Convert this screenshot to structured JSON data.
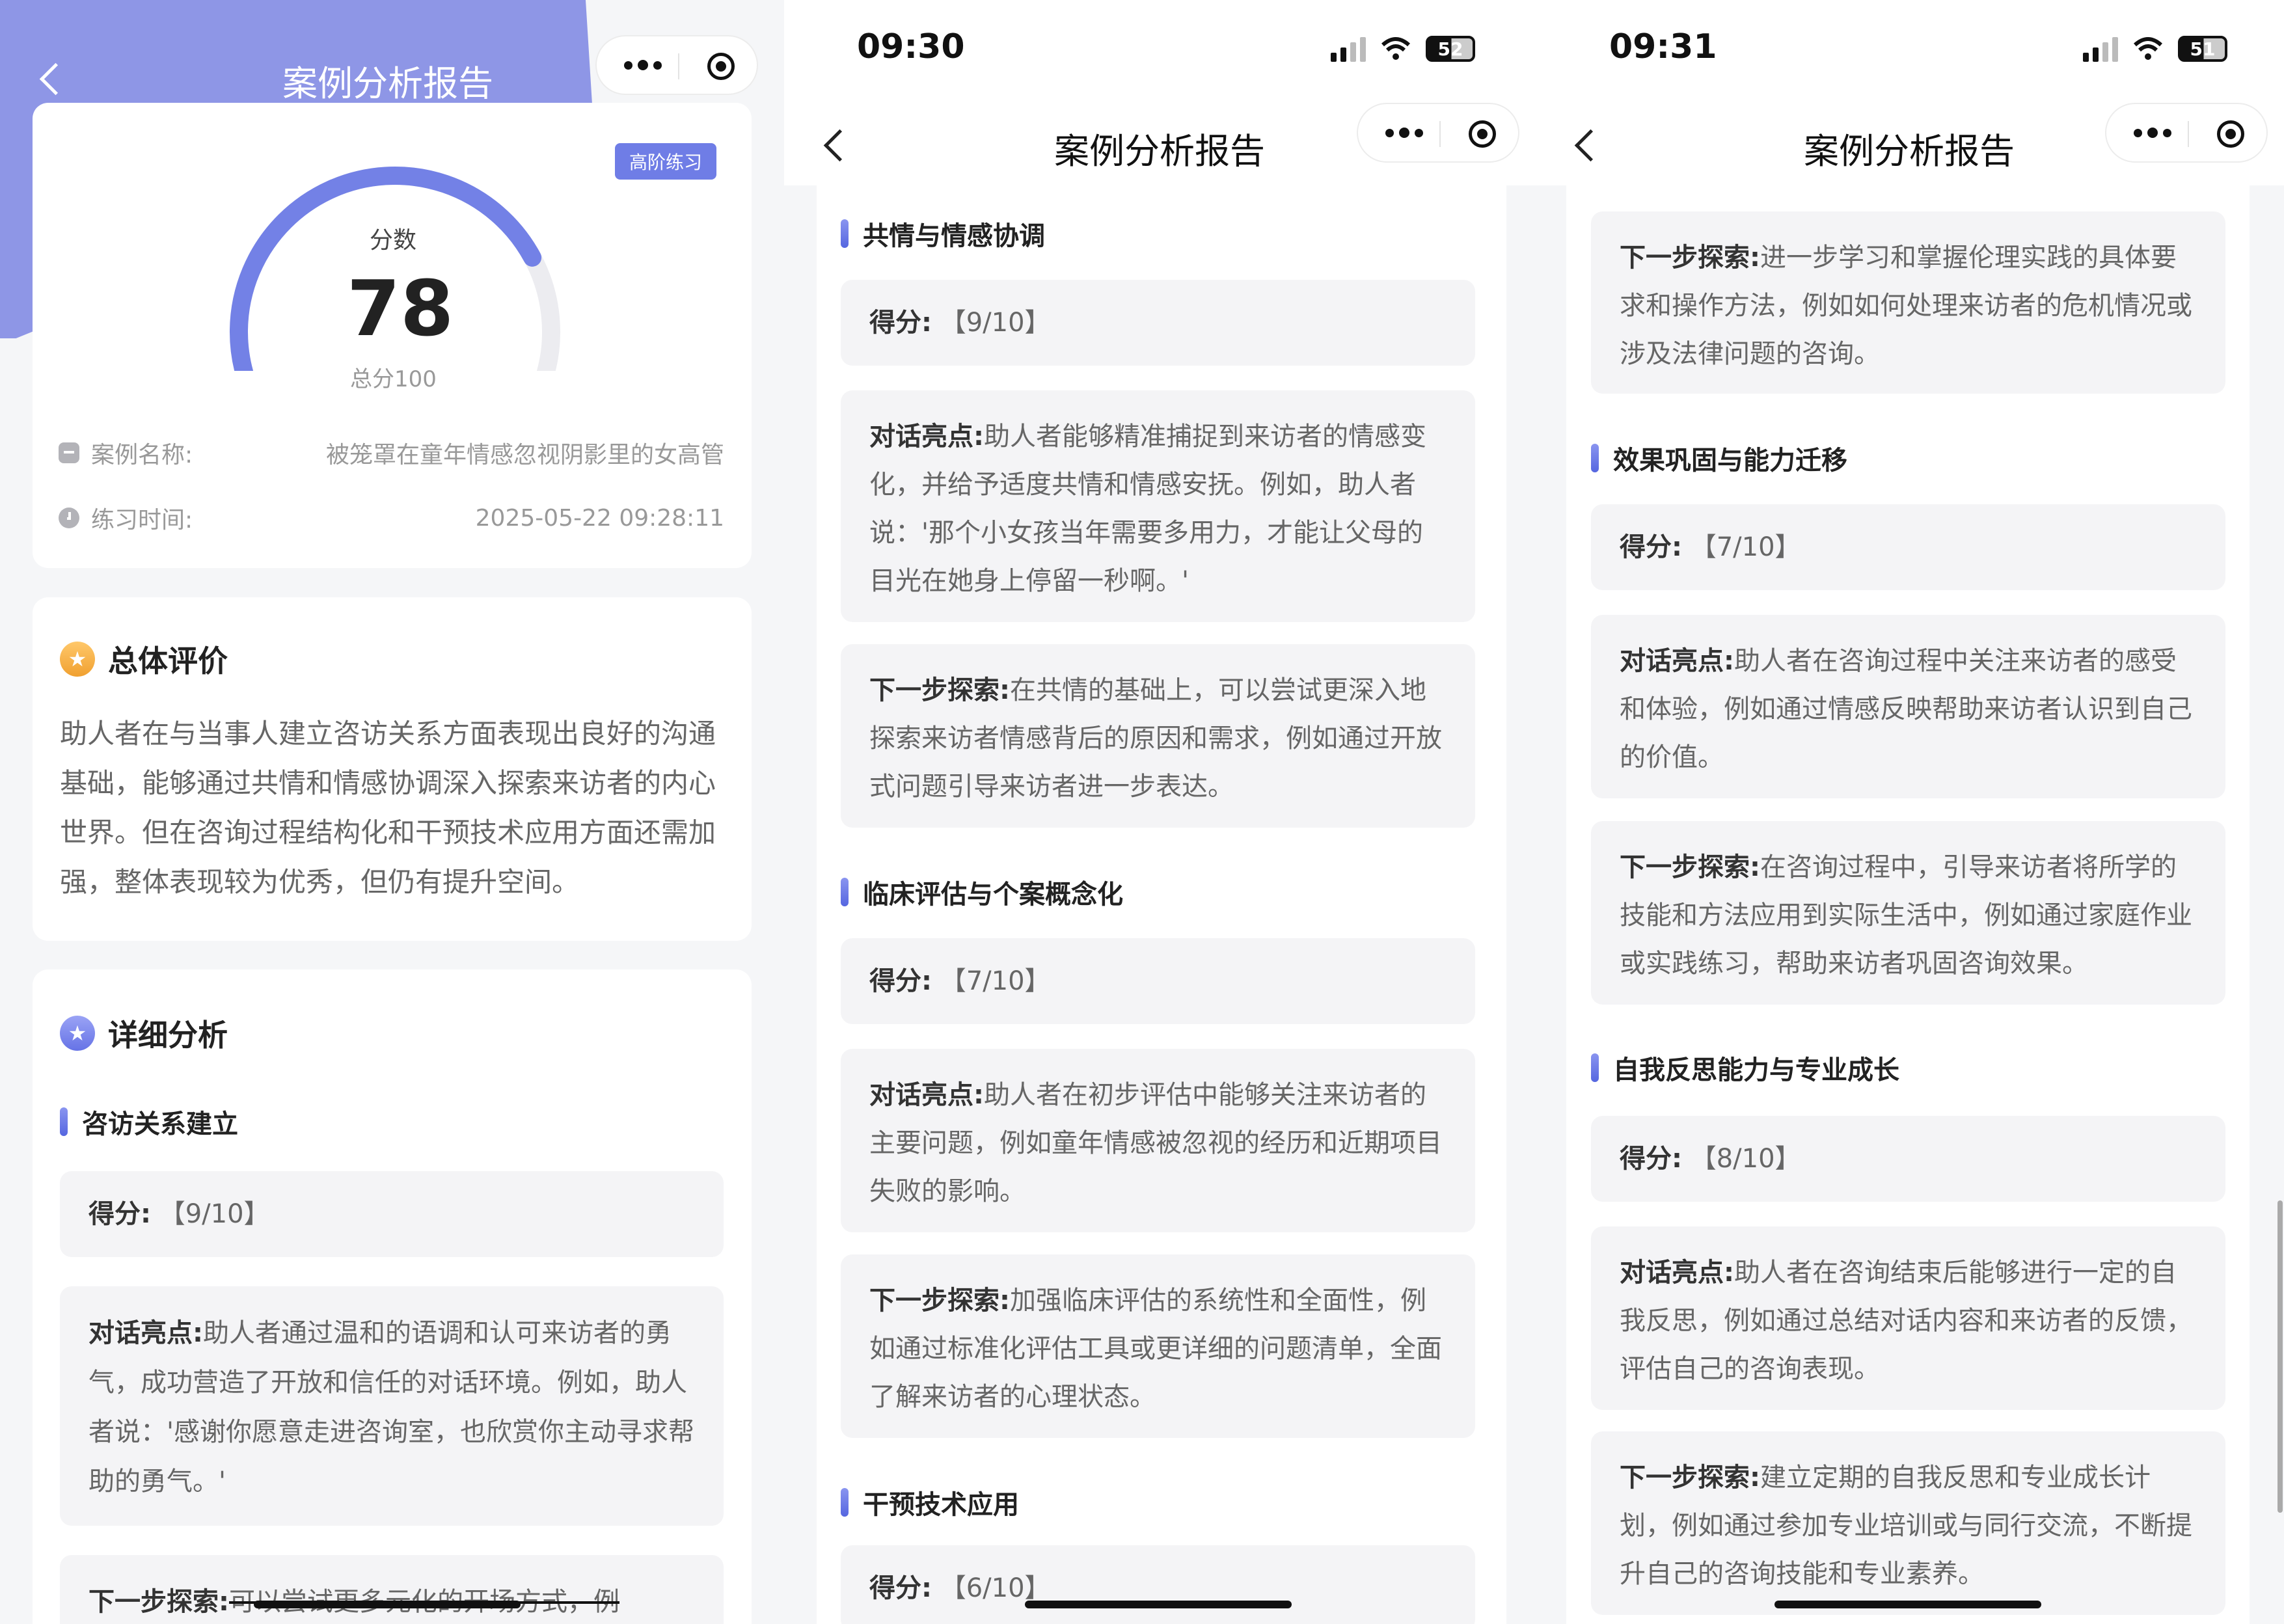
{
  "screen1": {
    "nav_title": "案例分析报告",
    "badge": "高阶练习",
    "gauge": {
      "label": "分数",
      "score": "78",
      "total_label": "总分100",
      "value": 78,
      "max": 100,
      "color": "#7381e6"
    },
    "case_name_label": "案例名称:",
    "case_name_value": "被笼罩在童年情感忽视阴影里的女高管",
    "practice_time_label": "练习时间:",
    "practice_time_value": "2025-05-22 09:28:11",
    "overall": {
      "title": "总体评价",
      "text": "助人者在与当事人建立咨访关系方面表现出良好的沟通基础，能够通过共情和情感协调深入探索来访者的内心世界。但在咨询过程结构化和干预技术应用方面还需加强，整体表现较为优秀，但仍有提升空间。"
    },
    "detail": {
      "title": "详细分析",
      "section": "咨访关系建立",
      "score_label": "得分:",
      "score_value": "【9/10】",
      "highlight_label": "对话亮点:",
      "highlight_text": "助人者通过温和的语调和认可来访者的勇气，成功营造了开放和信任的对话环境。例如，助人者说：'感谢你愿意走进咨询室，也欣赏你主动寻求帮助的勇气。'",
      "next_label": "下一步探索:",
      "next_text": "可以尝试更多元化的开场方式，例"
    }
  },
  "screen2": {
    "time": "09:30",
    "battery": "52",
    "nav_title": "案例分析报告",
    "sections": [
      {
        "title": "共情与情感协调",
        "score_label": "得分:",
        "score_value": "【9/10】",
        "highlight_label": "对话亮点:",
        "highlight_text": "助人者能够精准捕捉到来访者的情感变化，并给予适度共情和情感安抚。例如，助人者说：'那个小女孩当年需要多用力，才能让父母的目光在她身上停留一秒啊。'",
        "next_label": "下一步探索:",
        "next_text": "在共情的基础上，可以尝试更深入地探索来访者情感背后的原因和需求，例如通过开放式问题引导来访者进一步表达。"
      },
      {
        "title": "临床评估与个案概念化",
        "score_label": "得分:",
        "score_value": "【7/10】",
        "highlight_label": "对话亮点:",
        "highlight_text": "助人者在初步评估中能够关注来访者的主要问题，例如童年情感被忽视的经历和近期项目失败的影响。",
        "next_label": "下一步探索:",
        "next_text": "加强临床评估的系统性和全面性，例如通过标准化评估工具或更详细的问题清单，全面了解来访者的心理状态。"
      },
      {
        "title": "干预技术应用",
        "score_label": "得分:",
        "score_value": "【6/10】"
      }
    ]
  },
  "screen3": {
    "time": "09:31",
    "battery": "51",
    "nav_title": "案例分析报告",
    "top_next": {
      "next_label": "下一步探索:",
      "next_text": "进一步学习和掌握伦理实践的具体要求和操作方法，例如如何处理来访者的危机情况或涉及法律问题的咨询。"
    },
    "sections": [
      {
        "title": "效果巩固与能力迁移",
        "score_label": "得分:",
        "score_value": "【7/10】",
        "highlight_label": "对话亮点:",
        "highlight_text": "助人者在咨询过程中关注来访者的感受和体验，例如通过情感反映帮助来访者认识到自己的价值。",
        "next_label": "下一步探索:",
        "next_text": "在咨询过程中，引导来访者将所学的技能和方法应用到实际生活中，例如通过家庭作业或实践练习，帮助来访者巩固咨询效果。"
      },
      {
        "title": "自我反思能力与专业成长",
        "score_label": "得分:",
        "score_value": "【8/10】",
        "highlight_label": "对话亮点:",
        "highlight_text": "助人者在咨询结束后能够进行一定的自我反思，例如通过总结对话内容和来访者的反馈，评估自己的咨询表现。",
        "next_label": "下一步探索:",
        "next_text": "建立定期的自我反思和专业成长计划，例如通过参加专业培训或与同行交流，不断提升自己的咨询技能和专业素养。"
      }
    ]
  }
}
